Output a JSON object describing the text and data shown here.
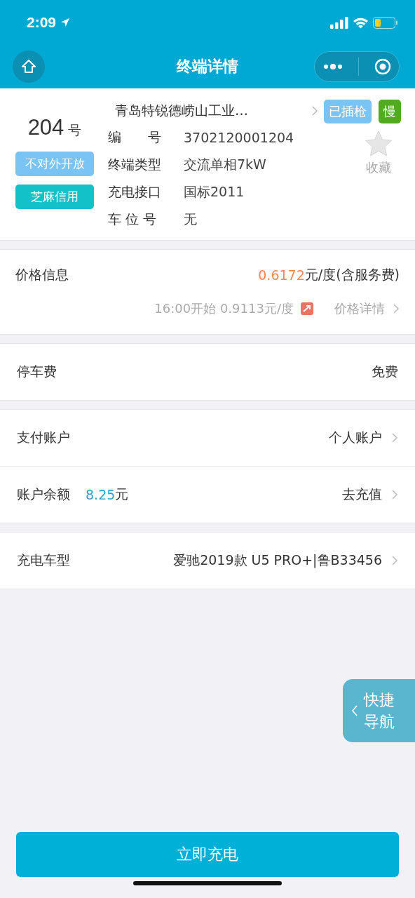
{
  "status_bar": {
    "time": "2:09"
  },
  "nav": {
    "title": "终端详情"
  },
  "terminal": {
    "number": "204",
    "number_unit": "号",
    "station": "青岛特锐德崂山工业…",
    "left_tags": [
      {
        "label": "不对外开放",
        "color": "#79c3f5"
      },
      {
        "label": "芝麻信用",
        "color": "#12c2c8"
      }
    ],
    "right_tags": [
      {
        "label": "已插枪",
        "color": "#79c3f5"
      },
      {
        "label": "慢",
        "color": "#52ab1f"
      }
    ],
    "fields": [
      {
        "label": "编　　号",
        "value": "3702120001204"
      },
      {
        "label": "终端类型",
        "value": "交流单相7kW"
      },
      {
        "label": "充电接口",
        "value": "国标2011"
      },
      {
        "label": "车 位 号",
        "value": "无"
      }
    ],
    "favorite": {
      "label": "收藏",
      "selected": false
    }
  },
  "price": {
    "label": "价格信息",
    "value": "0.6172",
    "unit": "元/度(含服务费)",
    "next": "16:00开始 0.9113元/度",
    "detail_link": "价格详情"
  },
  "groups": [
    [
      {
        "label": "停车费",
        "value": "免费",
        "arrow": false
      }
    ],
    [
      {
        "label": "支付账户",
        "value": "个人账户",
        "arrow": true
      },
      {
        "label": "账户余额",
        "amount": "8.25",
        "amount_unit": "元",
        "value": "去充值",
        "arrow": true
      }
    ],
    [
      {
        "label": "充电车型",
        "value": "爱驰2019款 U5 PRO+|鲁B33456",
        "arrow": true
      }
    ]
  ],
  "quick_nav": {
    "lines": [
      "快捷",
      "导航"
    ]
  },
  "action_button": "立即充电"
}
